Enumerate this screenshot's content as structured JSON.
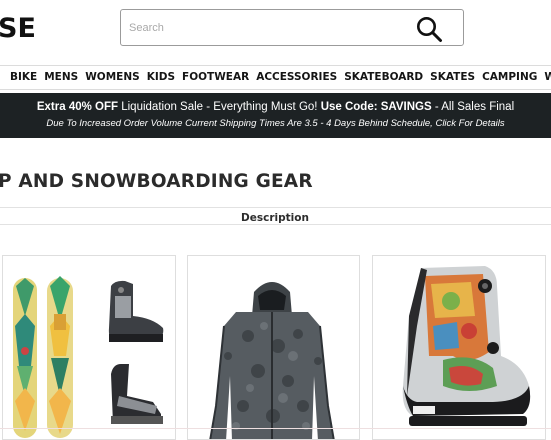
{
  "header": {
    "logo_text": "SE",
    "search_placeholder": "Search"
  },
  "nav": {
    "items": [
      "BIKE",
      "MENS",
      "WOMENS",
      "KIDS",
      "FOOTWEAR",
      "ACCESSORIES",
      "SKATEBOARD",
      "SKATES",
      "CAMPING",
      "WA"
    ]
  },
  "banner": {
    "line1": {
      "offer_bold": "Extra 40% OFF",
      "offer_text": "Liquidation Sale - Everything Must Go!",
      "code_bold": "Use Code: SAVINGS",
      "code_text": "- All Sales Final"
    },
    "line2": "Due To Increased Order Volume Current Shipping Times Are 3.5 - 4 Days Behind Schedule, Click For Details"
  },
  "page": {
    "title": "P AND SNOWBOARDING GEAR",
    "description_tab": "Description"
  },
  "products": [
    {
      "icon": "snowboard-package-image"
    },
    {
      "icon": "jacket-image"
    },
    {
      "icon": "snowboard-boot-image"
    }
  ],
  "colors": {
    "banner_bg": "#1d2224",
    "jacket": "#555b60",
    "board_green": "#3f9a6a",
    "board_yellow": "#e9d774"
  }
}
